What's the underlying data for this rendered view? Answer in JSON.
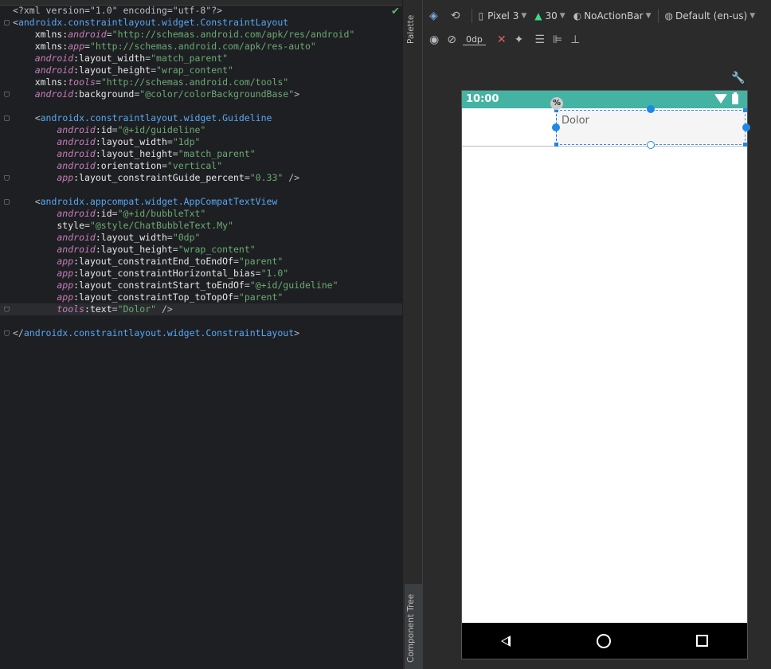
{
  "editor": {
    "lines": [
      {
        "parts": [
          [
            "p",
            "<?xml version=\"1.0\" encoding=\"utf-8\"?>"
          ]
        ]
      },
      {
        "parts": [
          [
            "p",
            "<"
          ],
          [
            "t",
            "androidx.constraintlayout.widget.ConstraintLayout"
          ]
        ]
      },
      {
        "parts": [
          [
            "nsb",
            "    xmlns:"
          ],
          [
            "ns",
            "android"
          ],
          [
            "p",
            "="
          ],
          [
            "v",
            "\"http://schemas.android.com/apk/res/android\""
          ]
        ]
      },
      {
        "parts": [
          [
            "nsb",
            "    xmlns:"
          ],
          [
            "ns",
            "app"
          ],
          [
            "p",
            "="
          ],
          [
            "v",
            "\"http://schemas.android.com/apk/res-auto\""
          ]
        ]
      },
      {
        "parts": [
          [
            "ns",
            "    android"
          ],
          [
            "nsb",
            ":layout_width"
          ],
          [
            "p",
            "="
          ],
          [
            "v",
            "\"match_parent\""
          ]
        ]
      },
      {
        "parts": [
          [
            "ns",
            "    android"
          ],
          [
            "nsb",
            ":layout_height"
          ],
          [
            "p",
            "="
          ],
          [
            "v",
            "\"wrap_content\""
          ]
        ]
      },
      {
        "parts": [
          [
            "nsb",
            "    xmlns:"
          ],
          [
            "ns",
            "tools"
          ],
          [
            "p",
            "="
          ],
          [
            "v",
            "\"http://schemas.android.com/tools\""
          ]
        ]
      },
      {
        "parts": [
          [
            "ns",
            "    android"
          ],
          [
            "nsb",
            ":background"
          ],
          [
            "p",
            "="
          ],
          [
            "v",
            "\"@color/colorBackgroundBase\""
          ],
          [
            "p",
            ">"
          ]
        ]
      },
      {
        "parts": [
          [
            "p",
            ""
          ]
        ]
      },
      {
        "parts": [
          [
            "p",
            "    <"
          ],
          [
            "t",
            "androidx.constraintlayout.widget.Guideline"
          ]
        ]
      },
      {
        "parts": [
          [
            "ns",
            "        android"
          ],
          [
            "nsb",
            ":id"
          ],
          [
            "p",
            "="
          ],
          [
            "v",
            "\"@+id/guideline\""
          ]
        ]
      },
      {
        "parts": [
          [
            "ns",
            "        android"
          ],
          [
            "nsb",
            ":layout_width"
          ],
          [
            "p",
            "="
          ],
          [
            "v",
            "\"1dp\""
          ]
        ]
      },
      {
        "parts": [
          [
            "ns",
            "        android"
          ],
          [
            "nsb",
            ":layout_height"
          ],
          [
            "p",
            "="
          ],
          [
            "v",
            "\"match_parent\""
          ]
        ]
      },
      {
        "parts": [
          [
            "ns",
            "        android"
          ],
          [
            "nsb",
            ":orientation"
          ],
          [
            "p",
            "="
          ],
          [
            "v",
            "\"vertical\""
          ]
        ]
      },
      {
        "parts": [
          [
            "ns",
            "        app"
          ],
          [
            "nsb",
            ":layout_constraintGuide_percent"
          ],
          [
            "p",
            "="
          ],
          [
            "v",
            "\"0.33\""
          ],
          [
            "p",
            " />"
          ]
        ]
      },
      {
        "parts": [
          [
            "p",
            ""
          ]
        ]
      },
      {
        "parts": [
          [
            "p",
            "    <"
          ],
          [
            "t",
            "androidx.appcompat.widget.AppCompatTextView"
          ]
        ]
      },
      {
        "parts": [
          [
            "ns",
            "        android"
          ],
          [
            "nsb",
            ":id"
          ],
          [
            "p",
            "="
          ],
          [
            "v",
            "\"@+id/bubbleTxt\""
          ]
        ]
      },
      {
        "parts": [
          [
            "nsb",
            "        style"
          ],
          [
            "p",
            "="
          ],
          [
            "v",
            "\"@style/ChatBubbleText.My\""
          ]
        ]
      },
      {
        "parts": [
          [
            "ns",
            "        android"
          ],
          [
            "nsb",
            ":layout_width"
          ],
          [
            "p",
            "="
          ],
          [
            "v",
            "\"0dp\""
          ]
        ]
      },
      {
        "parts": [
          [
            "ns",
            "        android"
          ],
          [
            "nsb",
            ":layout_height"
          ],
          [
            "p",
            "="
          ],
          [
            "v",
            "\"wrap_content\""
          ]
        ]
      },
      {
        "parts": [
          [
            "ns",
            "        app"
          ],
          [
            "nsb",
            ":layout_constraintEnd_toEndOf"
          ],
          [
            "p",
            "="
          ],
          [
            "v",
            "\"parent\""
          ]
        ]
      },
      {
        "parts": [
          [
            "ns",
            "        app"
          ],
          [
            "nsb",
            ":layout_constraintHorizontal_bias"
          ],
          [
            "p",
            "="
          ],
          [
            "v",
            "\"1.0\""
          ]
        ]
      },
      {
        "parts": [
          [
            "ns",
            "        app"
          ],
          [
            "nsb",
            ":layout_constraintStart_toEndOf"
          ],
          [
            "p",
            "="
          ],
          [
            "v",
            "\"@+id/guideline\""
          ]
        ]
      },
      {
        "parts": [
          [
            "ns",
            "        app"
          ],
          [
            "nsb",
            ":layout_constraintTop_toTopOf"
          ],
          [
            "p",
            "="
          ],
          [
            "v",
            "\"parent\""
          ]
        ]
      },
      {
        "parts": [
          [
            "ns",
            "        tools"
          ],
          [
            "nsb",
            ":text"
          ],
          [
            "p",
            "="
          ],
          [
            "v",
            "\"Dolor\""
          ],
          [
            "p",
            " />"
          ]
        ]
      },
      {
        "parts": [
          [
            "p",
            ""
          ]
        ]
      },
      {
        "parts": [
          [
            "p",
            "</"
          ],
          [
            "t",
            "androidx.constraintlayout.widget.ConstraintLayout"
          ],
          [
            "p",
            ">"
          ]
        ]
      }
    ]
  },
  "side_tabs": {
    "palette": "Palette",
    "component_tree": "Component Tree"
  },
  "toolbar": {
    "device": "Pixel 3",
    "api_level": "30",
    "theme": "NoActionBar",
    "locale": "Default (en-us)",
    "default_margin": "0dp"
  },
  "phone": {
    "status_time": "10:00",
    "percent_badge": "%",
    "bubble_text": "Dolor"
  },
  "colors": {
    "status_bar": "#45b3a3",
    "selection": "#1e88e5",
    "editor_bg": "#1e1f22"
  }
}
